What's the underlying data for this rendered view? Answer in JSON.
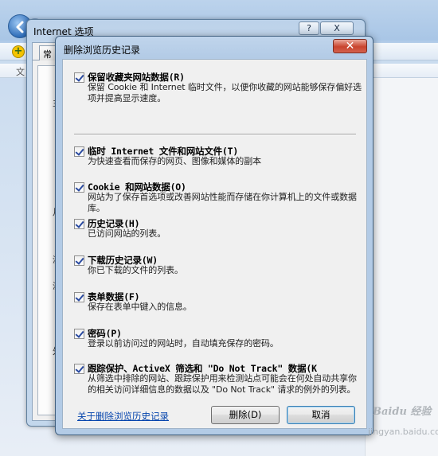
{
  "background": {
    "tab_label": "文"
  },
  "options_window": {
    "title": "Internet 选项",
    "help_label": "?",
    "close_label": "X",
    "tab_first": "常",
    "edge_chars": [
      "主",
      "月",
      "浏",
      "浏",
      "外"
    ]
  },
  "dialog": {
    "title": "删除浏览历史记录",
    "close_label": "✕",
    "options": [
      {
        "label": "保留收藏夹网站数据(R)",
        "description": "保留 Cookie 和 Internet 临时文件，以便你收藏的网站能够保存偏好选项并提高显示速度。",
        "checked": true
      },
      {
        "label": "临时 Internet 文件和网站文件(T)",
        "description": "为快速查看而保存的网页、图像和媒体的副本",
        "checked": true
      },
      {
        "label": "Cookie 和网站数据(O)",
        "description": "网站为了保存首选项或改善网站性能而存储在你计算机上的文件或数据库。",
        "checked": true
      },
      {
        "label": "历史记录(H)",
        "description": "已访问网站的列表。",
        "checked": true
      },
      {
        "label": "下载历史记录(W)",
        "description": "你已下载的文件的列表。",
        "checked": true
      },
      {
        "label": "表单数据(F)",
        "description": "保存在表单中键入的信息。",
        "checked": true
      },
      {
        "label": "密码(P)",
        "description": "登录以前访问过的网站时，自动填充保存的密码。",
        "checked": true
      },
      {
        "label": "跟踪保护、ActiveX 筛选和 \"Do Not Track\" 数据(K",
        "description": "从筛选中排除的网站、跟踪保护用来检测站点可能会在何处自动共享你的相关访问详细信息的数据以及 \"Do Not Track\" 请求的例外的列表。",
        "checked": true
      }
    ],
    "about_link": "关于删除浏览历史记录",
    "delete_button": "删除(D)",
    "cancel_button": "取消"
  },
  "watermark": {
    "brand": "Baidu 经验",
    "url": "jingyan.baidu.com"
  }
}
